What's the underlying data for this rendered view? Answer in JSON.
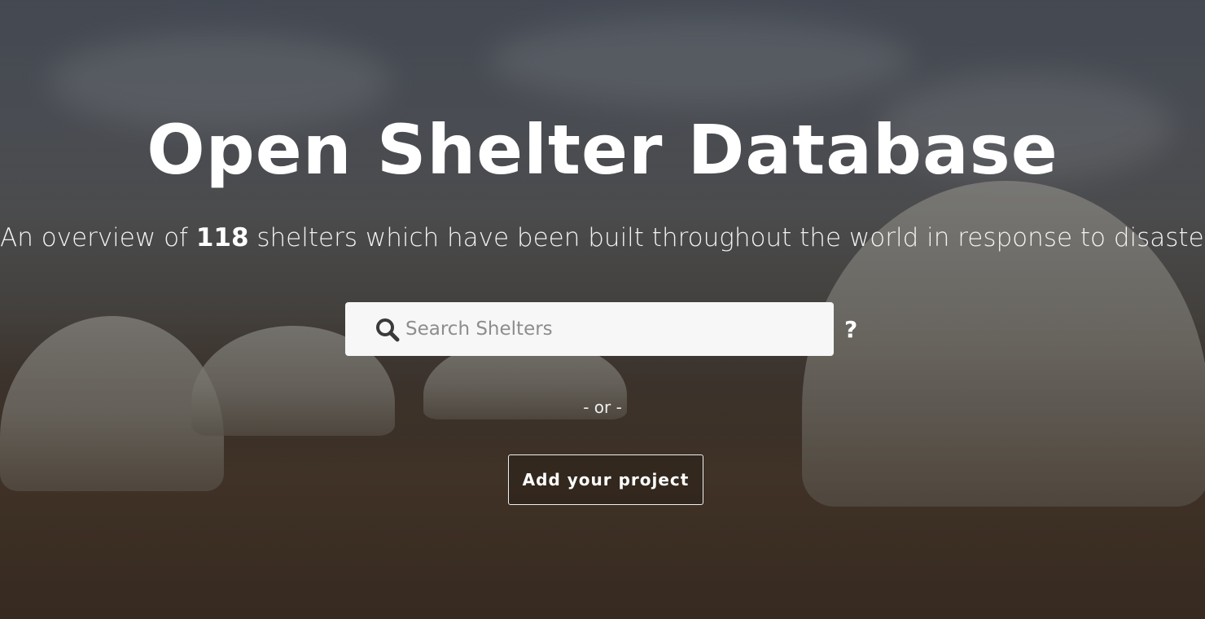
{
  "hero": {
    "title": "Open Shelter Database",
    "subtitle_prefix": "An overview of ",
    "shelter_count": "118",
    "subtitle_suffix": " shelters which have been built throughout the world in response to disasters"
  },
  "search": {
    "placeholder": "Search Shelters",
    "value": "",
    "icon": "search-icon",
    "help_label": "?"
  },
  "divider_text": "- or -",
  "cta": {
    "label": "Add your project"
  },
  "colors": {
    "text": "#ffffff",
    "search_bg": "#f7f7f7",
    "placeholder": "#8d8d8d"
  }
}
